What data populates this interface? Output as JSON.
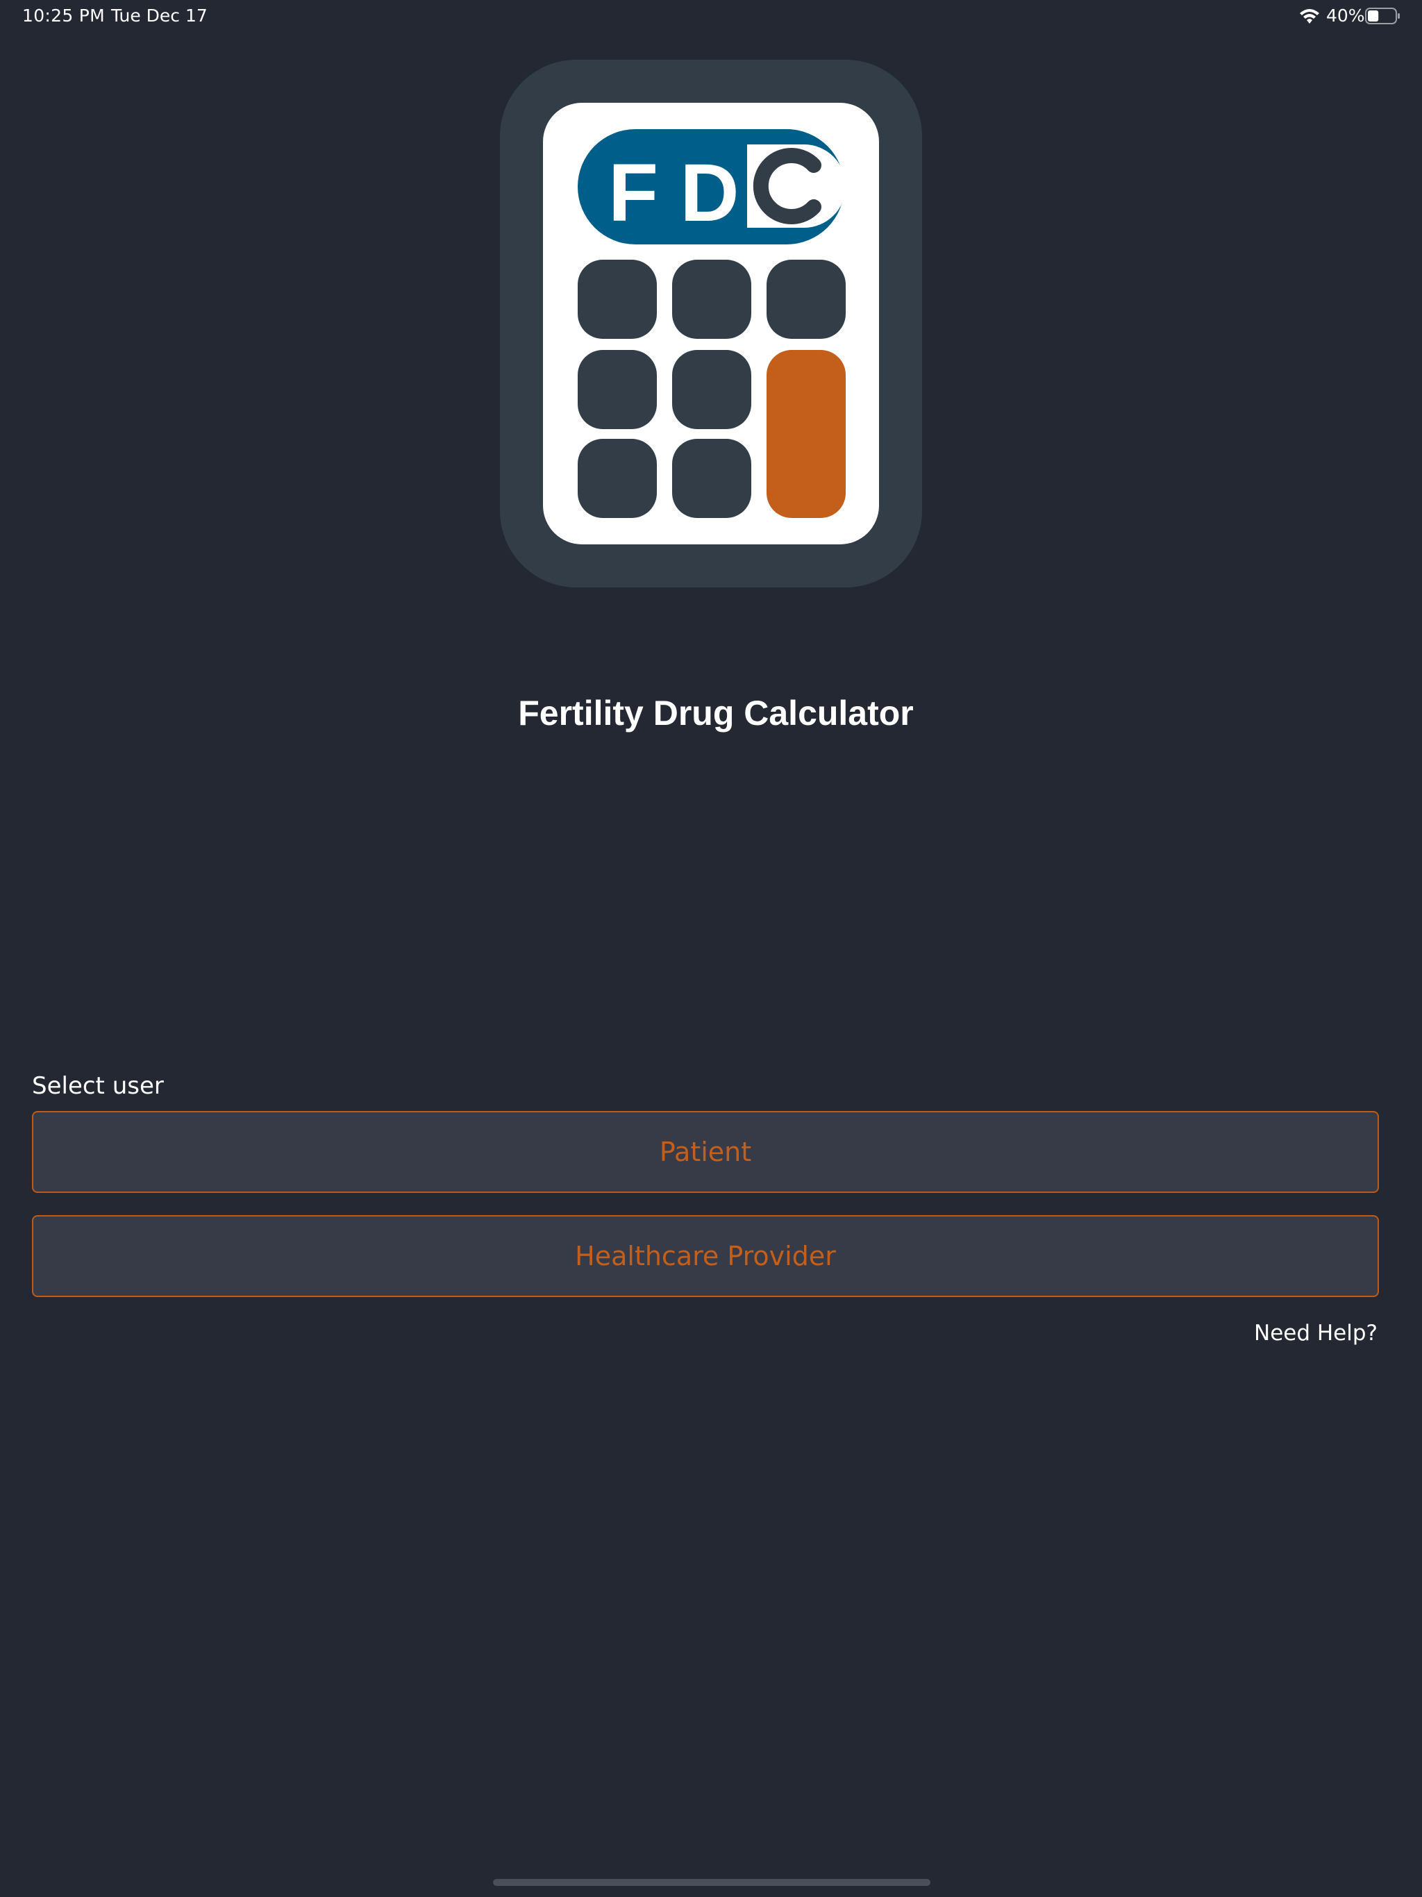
{
  "status_bar": {
    "time": "10:25 PM",
    "date": "Tue Dec 17",
    "battery": "40%",
    "battery_level": 0.4
  },
  "logo": {
    "letter_f": "F",
    "letter_d": "D",
    "letter_c": "C",
    "icon": "calculator-logo-icon"
  },
  "app": {
    "title": "Fertility Drug Calculator"
  },
  "user_select": {
    "label": "Select user",
    "options": [
      "Patient",
      "Healthcare Provider"
    ]
  },
  "help": {
    "label": "Need Help?"
  },
  "colors": {
    "background": "#232832",
    "accent": "#c35f1b",
    "logo_blue": "#005f8a",
    "logo_key": "#333d47",
    "button_bg": "#363b47"
  }
}
